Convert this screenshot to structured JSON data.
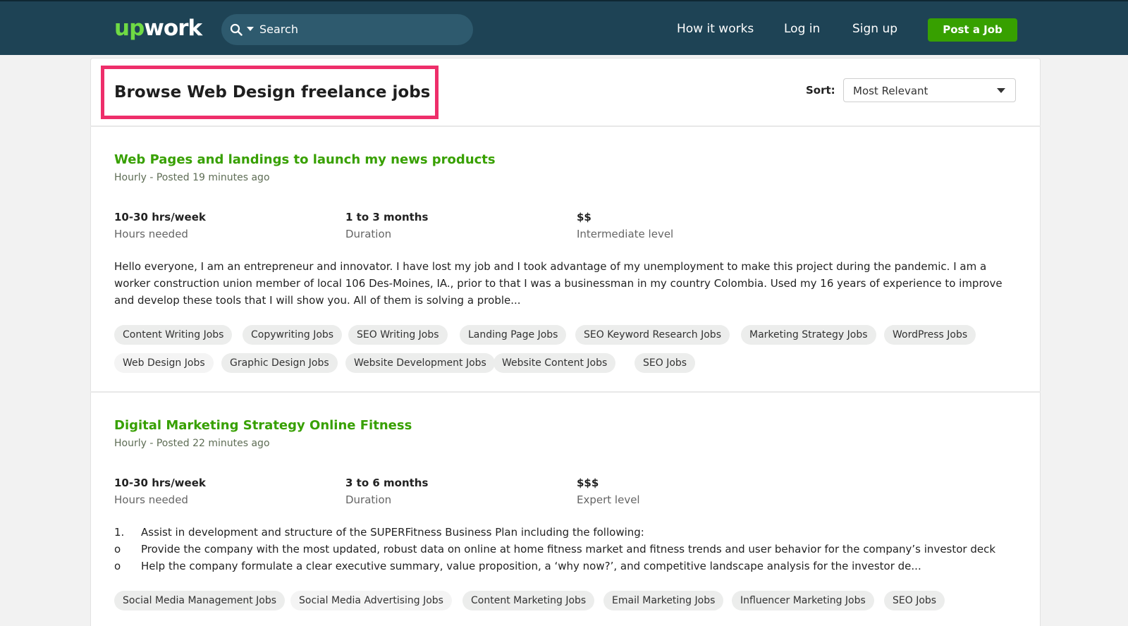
{
  "header": {
    "logo_up": "up",
    "logo_work": "work",
    "search_placeholder": "Search",
    "nav": {
      "how_it_works": "How it works",
      "log_in": "Log in",
      "sign_up": "Sign up",
      "post_job": "Post a Job"
    }
  },
  "page": {
    "title": "Browse Web Design freelance jobs",
    "sort_label": "Sort:",
    "sort_value": "Most Relevant",
    "highlight_color": "#ee2e6a"
  },
  "jobs": [
    {
      "title": "Web Pages and landings to launch my news products",
      "meta": "Hourly - Posted 19 minutes ago",
      "stats": [
        {
          "value": "10-30 hrs/week",
          "label": "Hours needed"
        },
        {
          "value": "1 to 3 months",
          "label": "Duration"
        },
        {
          "value": "$$",
          "label": "Intermediate level"
        }
      ],
      "description": "Hello everyone, I am an entrepreneur and innovator. I have lost my job and I took advantage of my unemployment to make this project during the pandemic. I am a worker construction union member of local 106 Des-Moines, IA., prior to that I was a businessman in my country Colombia. Used my 16 years of experience to improve and develop these tools that I will show you. All of them is solving a proble...",
      "tags": [
        "Content Writing Jobs",
        "Copywriting Jobs",
        "SEO Writing Jobs",
        "Landing Page Jobs",
        "SEO Keyword Research Jobs",
        "Marketing Strategy Jobs",
        "WordPress Jobs",
        "Web Design Jobs",
        "Graphic Design Jobs",
        "Website Development Jobs",
        "Website Content Jobs",
        "SEO Jobs"
      ]
    },
    {
      "title": "Digital Marketing Strategy Online Fitness",
      "meta": "Hourly - Posted 22 minutes ago",
      "stats": [
        {
          "value": "10-30 hrs/week",
          "label": "Hours needed"
        },
        {
          "value": "3 to 6 months",
          "label": "Duration"
        },
        {
          "value": "$$$",
          "label": "Expert level"
        }
      ],
      "description_lines": [
        {
          "marker": "1.",
          "text": "Assist in development and structure of the SUPERFitness Business Plan including the following:"
        },
        {
          "marker": "o",
          "text": "Provide the company with the most updated, robust data on online at home fitness market and fitness trends and user behavior for the company’s investor deck"
        },
        {
          "marker": "o",
          "text": "Help the company formulate a clear executive summary, value proposition, a ‘why now?’, and competitive landscape analysis for the investor de..."
        }
      ],
      "tags": [
        "Social Media Management Jobs",
        "Social Media Advertising Jobs",
        "Content Marketing Jobs",
        "Email Marketing Jobs",
        "Influencer Marketing Jobs",
        "SEO Jobs"
      ]
    }
  ],
  "colors": {
    "header_bg": "#1e4355",
    "brand_green": "#6fda44",
    "button_green": "#37a000",
    "title_green": "#37a000"
  }
}
